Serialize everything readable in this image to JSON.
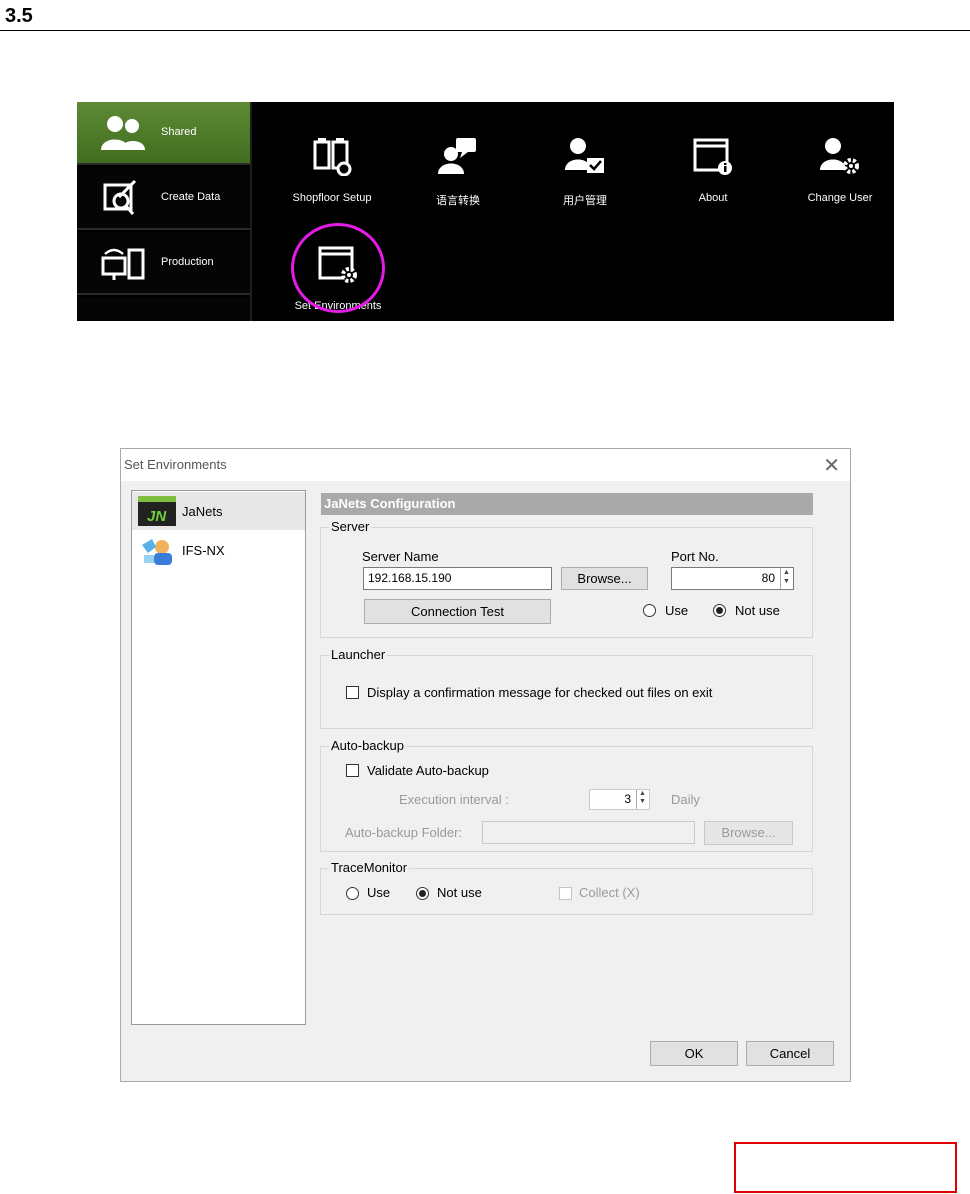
{
  "section": {
    "number": "3.5"
  },
  "launcher": {
    "sidebar": [
      {
        "label": "Shared",
        "icon": "users-icon",
        "active": true
      },
      {
        "label": "Create Data",
        "icon": "create-data-icon",
        "active": false
      },
      {
        "label": "Production",
        "icon": "production-icon",
        "active": false
      },
      {
        "label": "",
        "icon": "tools-icon",
        "active": false
      }
    ],
    "tiles": [
      {
        "label": "Shopfloor Setup",
        "icon": "shopfloor-setup-icon"
      },
      {
        "label": "语言转换",
        "icon": "chat-icon"
      },
      {
        "label": "用户管理",
        "icon": "user-manage-icon"
      },
      {
        "label": "About",
        "icon": "about-info-icon"
      },
      {
        "label": "Change User",
        "icon": "change-user-icon"
      },
      {
        "label": "Set Environments",
        "icon": "set-environments-icon"
      }
    ],
    "highlight_color": "#e41be4"
  },
  "dialog": {
    "title": "Set Environments",
    "nav": [
      {
        "label": "JaNets",
        "icon": "janets-icon",
        "selected": true
      },
      {
        "label": "IFS-NX",
        "icon": "ifs-nx-icon",
        "selected": false
      }
    ],
    "header": "JaNets Configuration",
    "server": {
      "group_title": "Server",
      "server_name_label": "Server Name",
      "server_name_value": "192.168.15.190",
      "browse_label": "Browse...",
      "port_label": "Port No.",
      "port_value": "80",
      "connection_test_label": "Connection Test",
      "use_label": "Use",
      "not_use_label": "Not use",
      "selected": "Not use"
    },
    "launcher_group": {
      "group_title": "Launcher",
      "confirm_label": "Display a confirmation message for checked out files on exit",
      "confirm_checked": false
    },
    "autobackup": {
      "group_title": "Auto-backup",
      "validate_label": "Validate Auto-backup",
      "validate_checked": false,
      "interval_label": "Execution interval :",
      "interval_value": "3",
      "interval_unit": "Daily",
      "folder_label": "Auto-backup Folder:",
      "folder_value": "",
      "browse_label": "Browse..."
    },
    "tracemonitor": {
      "group_title": "TraceMonitor",
      "use_label": "Use",
      "not_use_label": "Not use",
      "selected": "Not use",
      "collect_label": "Collect (X)",
      "collect_checked": false
    },
    "ok_label": "OK",
    "cancel_label": "Cancel"
  },
  "annotation_box_color": "#e00000"
}
